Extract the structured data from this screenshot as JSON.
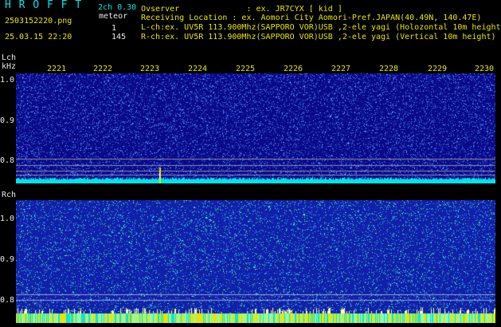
{
  "header": {
    "brand": "H R O F F T",
    "version": "2ch 0.30",
    "filename": "2503152220.png",
    "timestamp": "25.03.15 22:20",
    "meteor_label": "meteor",
    "meteor_count": "1",
    "hits_count": "145"
  },
  "info": {
    "observer": "Ovserver              : ex. JR7CYX [ kid ]",
    "location": "Receiving Location : ex. Aomori City Aomori-Pref.JAPAN(40.49N, 140.47E)",
    "lch": "L-ch:ex. UV5R 113.900Mhz(SAPPORO VOR)USB ,2-ele yagi (Holozontal 10m height)",
    "rch": "R-ch:ex. UV5R 113.900Mhz(SAPPORO VOR)USB ,2-ele yagi (Vertical 10m height)"
  },
  "time_ticks": [
    "2221",
    "2222",
    "2223",
    "2224",
    "2225",
    "2226",
    "2227",
    "2228",
    "2229",
    "2230"
  ],
  "lch_panel": {
    "label": "Lch",
    "unit": "kHz",
    "y_ticks": [
      "1.0",
      "0.9",
      "0.8"
    ],
    "background": "#0a0a88",
    "noise_color": "#3c78ff",
    "baseline_color": "#00e5e5"
  },
  "rch_panel": {
    "label": "Rch",
    "y_ticks": [
      "1.0",
      "0.9",
      "0.8"
    ],
    "background": "#1020a8",
    "noise_color": "#40c0ff",
    "baseline_colors": [
      "#00e5e5",
      "#e6e600"
    ]
  },
  "colors": {
    "text_cyan": "#00e5e5",
    "text_yellow": "#e6e600",
    "text_white": "#e8e8e8"
  }
}
